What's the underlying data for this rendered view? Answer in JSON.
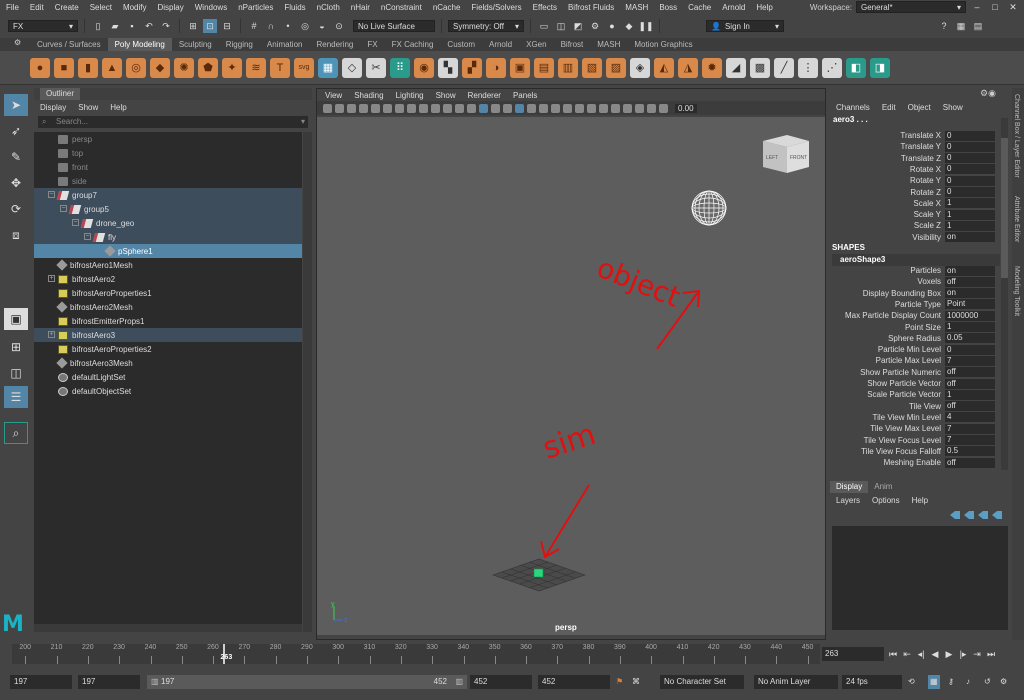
{
  "menubar": {
    "items": [
      "File",
      "Edit",
      "Create",
      "Select",
      "Modify",
      "Display",
      "Windows",
      "nParticles",
      "Fluids",
      "nCloth",
      "nHair",
      "nConstraint",
      "nCache",
      "Fields/Solvers",
      "Effects",
      "Bifrost Fluids",
      "MASH",
      "Boss",
      "Cache",
      "Arnold",
      "Help"
    ],
    "workspace_label": "Workspace:",
    "workspace_value": "General*"
  },
  "statusline": {
    "menuset": "FX",
    "live_surface": "No Live Surface",
    "symmetry": "Symmetry: Off",
    "sign_in": "Sign In"
  },
  "shelf": {
    "tabs": [
      "Curves / Surfaces",
      "Poly Modeling",
      "Sculpting",
      "Rigging",
      "Animation",
      "Rendering",
      "FX",
      "FX Caching",
      "Custom",
      "Arnold",
      "XGen",
      "Bifrost",
      "MASH",
      "Motion Graphics"
    ],
    "active_tab": "Poly Modeling",
    "text_icons": {
      "t_label": "T",
      "svg_label": "svg"
    }
  },
  "outliner": {
    "title": "Outliner",
    "menu": [
      "Display",
      "Show",
      "Help"
    ],
    "search_placeholder": "Search...",
    "items": [
      {
        "label": "persp",
        "icon": "cam",
        "indent": 24,
        "state": "dim"
      },
      {
        "label": "top",
        "icon": "cam",
        "indent": 24,
        "state": "dim"
      },
      {
        "label": "front",
        "icon": "cam",
        "indent": 24,
        "state": "dim"
      },
      {
        "label": "side",
        "icon": "cam",
        "indent": 24,
        "state": "dim"
      },
      {
        "label": "group7",
        "icon": "grp",
        "indent": 24,
        "state": "par"
      },
      {
        "label": "group5",
        "icon": "grp",
        "indent": 36,
        "state": "par"
      },
      {
        "label": "drone_geo",
        "icon": "grp",
        "indent": 48,
        "state": "par"
      },
      {
        "label": "fly",
        "icon": "grp",
        "indent": 60,
        "state": "par"
      },
      {
        "label": "pSphere1",
        "icon": "mesh",
        "indent": 72,
        "state": "sel"
      },
      {
        "label": "bifrostAero1Mesh",
        "icon": "mesh",
        "indent": 24,
        "state": ""
      },
      {
        "label": "bifrostAero2",
        "icon": "bf",
        "indent": 24,
        "state": ""
      },
      {
        "label": "bifrostAeroProperties1",
        "icon": "bf",
        "indent": 24,
        "state": ""
      },
      {
        "label": "bifrostAero2Mesh",
        "icon": "mesh",
        "indent": 24,
        "state": ""
      },
      {
        "label": "bifrostEmitterProps1",
        "icon": "bf",
        "indent": 24,
        "state": ""
      },
      {
        "label": "bifrostAero3",
        "icon": "bf",
        "indent": 24,
        "state": "par"
      },
      {
        "label": "bifrostAeroProperties2",
        "icon": "bf",
        "indent": 24,
        "state": ""
      },
      {
        "label": "bifrostAero3Mesh",
        "icon": "mesh",
        "indent": 24,
        "state": ""
      },
      {
        "label": "defaultLightSet",
        "icon": "set",
        "indent": 24,
        "state": ""
      },
      {
        "label": "defaultObjectSet",
        "icon": "set",
        "indent": 24,
        "state": ""
      }
    ]
  },
  "viewport": {
    "menu": [
      "View",
      "Shading",
      "Lighting",
      "Show",
      "Renderer",
      "Panels"
    ],
    "zoom_value": "0.00",
    "camera_label": "persp",
    "viewcube_left": "LEFT",
    "viewcube_front": "FRONT",
    "annotation_object": "object",
    "annotation_sim": "sim",
    "axis_y": "y",
    "axis_z": "z"
  },
  "channelbox": {
    "menu": [
      "Channels",
      "Edit",
      "Object",
      "Show"
    ],
    "object_name": "aero3 . . .",
    "transform_attrs": [
      {
        "label": "Translate X",
        "value": "0"
      },
      {
        "label": "Translate Y",
        "value": "0"
      },
      {
        "label": "Translate Z",
        "value": "0"
      },
      {
        "label": "Rotate X",
        "value": "0"
      },
      {
        "label": "Rotate Y",
        "value": "0"
      },
      {
        "label": "Rotate Z",
        "value": "0"
      },
      {
        "label": "Scale X",
        "value": "1"
      },
      {
        "label": "Scale Y",
        "value": "1"
      },
      {
        "label": "Scale Z",
        "value": "1"
      },
      {
        "label": "Visibility",
        "value": "on"
      }
    ],
    "shapes_header": "SHAPES",
    "shape_name": "aeroShape3",
    "shape_attrs": [
      {
        "label": "Particles",
        "value": "on"
      },
      {
        "label": "Voxels",
        "value": "off"
      },
      {
        "label": "Display Bounding Box",
        "value": "on"
      },
      {
        "label": "Particle Type",
        "value": "Point"
      },
      {
        "label": "Max Particle Display Count",
        "value": "1000000"
      },
      {
        "label": "Point Size",
        "value": "1"
      },
      {
        "label": "Sphere Radius",
        "value": "0.05"
      },
      {
        "label": "Particle Min Level",
        "value": "0"
      },
      {
        "label": "Particle Max Level",
        "value": "7"
      },
      {
        "label": "Show Particle Numeric",
        "value": "off"
      },
      {
        "label": "Show Particle Vector",
        "value": "off"
      },
      {
        "label": "Scale Particle Vector",
        "value": "1"
      },
      {
        "label": "Tile View",
        "value": "off"
      },
      {
        "label": "Tile View Min Level",
        "value": "4"
      },
      {
        "label": "Tile View Max Level",
        "value": "7"
      },
      {
        "label": "Tile View Focus Level",
        "value": "7"
      },
      {
        "label": "Tile View Focus Falloff",
        "value": "0.5"
      },
      {
        "label": "Meshing Enable",
        "value": "off"
      }
    ]
  },
  "sidetabs": [
    "Channel Box / Layer Editor",
    "Attribute Editor",
    "Modeling Toolkit"
  ],
  "layereditor": {
    "tabs": [
      "Display",
      "Anim"
    ],
    "menu": [
      "Layers",
      "Options",
      "Help"
    ]
  },
  "timeline": {
    "ticks": [
      "200",
      "210",
      "220",
      "230",
      "240",
      "250",
      "260",
      "270",
      "280",
      "290",
      "300",
      "310",
      "320",
      "330",
      "340",
      "350",
      "360",
      "370",
      "380",
      "390",
      "400",
      "410",
      "420",
      "430",
      "440",
      "450"
    ],
    "current_frame": "263",
    "current_frame_field": "263"
  },
  "range": {
    "start_min": "197",
    "start": "197",
    "bar_start": "197",
    "bar_end": "452",
    "end": "452",
    "end_max": "452",
    "character_set": "No Character Set",
    "anim_layer": "No Anim Layer",
    "fps": "24 fps"
  },
  "colors": {
    "accent": "#5285a6",
    "annotation": "#e01010",
    "maya_logo": "#19b3c6"
  }
}
